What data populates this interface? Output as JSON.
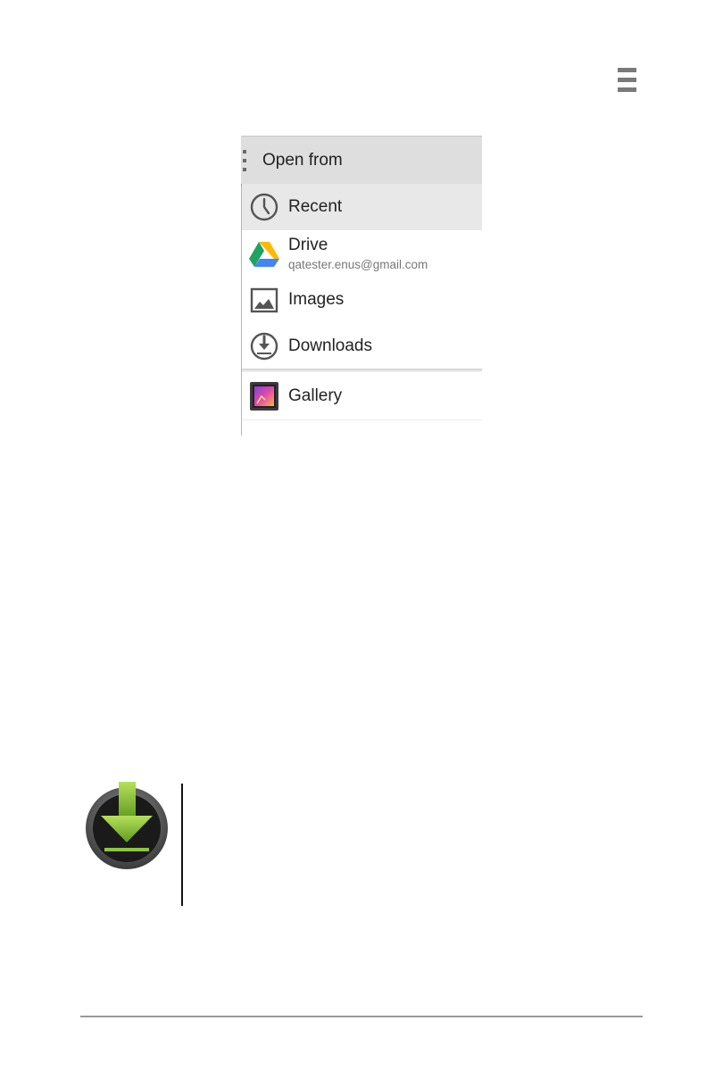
{
  "dialog": {
    "title": "Open from",
    "items": [
      {
        "label": "Recent",
        "icon": "clock-icon",
        "selected": true
      },
      {
        "label": "Drive",
        "sublabel": "qatester.enus@gmail.com",
        "icon": "google-drive-icon"
      },
      {
        "label": "Images",
        "icon": "image-icon"
      },
      {
        "label": "Downloads",
        "icon": "download-circle-icon"
      },
      {
        "label": "Gallery",
        "icon": "gallery-app-icon"
      }
    ]
  },
  "icons": {
    "menu_glyph": "menu-icon",
    "callout": "download-app-icon"
  },
  "colors": {
    "header_bg": "#dedede",
    "selected_row": "#e8e8e8",
    "drive_green": "#1ea362",
    "drive_yellow": "#ffba00",
    "drive_blue": "#4285f4",
    "download_green": "#8cc63f"
  }
}
